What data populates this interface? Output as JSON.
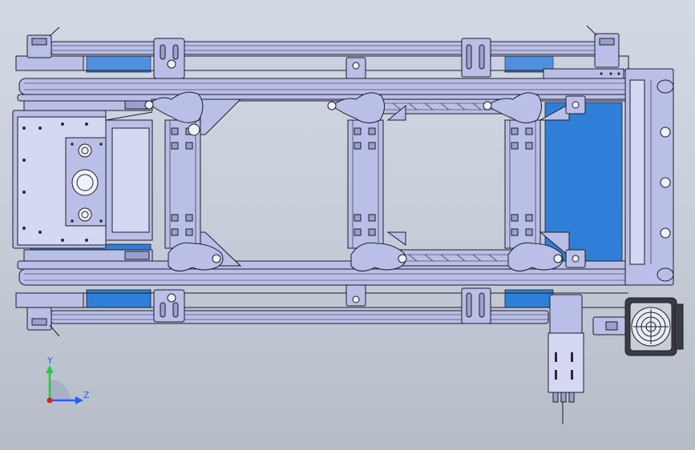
{
  "viewport": {
    "background_top": "#d3d9e4",
    "background_bottom": "#b6bcc6"
  },
  "colors": {
    "part_fill": "#b9bfe6",
    "part_fill_light": "#d4d8f2",
    "part_fill_dark": "#9aa0cc",
    "edge": "#1e1e2a",
    "belt_blue": "#2f7fd8",
    "belt_blue_dark": "#1c64b8",
    "motor_dark": "#3a3c44"
  },
  "triad": {
    "y_label": "Y",
    "z_label": "Z",
    "y_color": "#27c93f",
    "z_color": "#2060ff",
    "x_color": "#e02020"
  }
}
